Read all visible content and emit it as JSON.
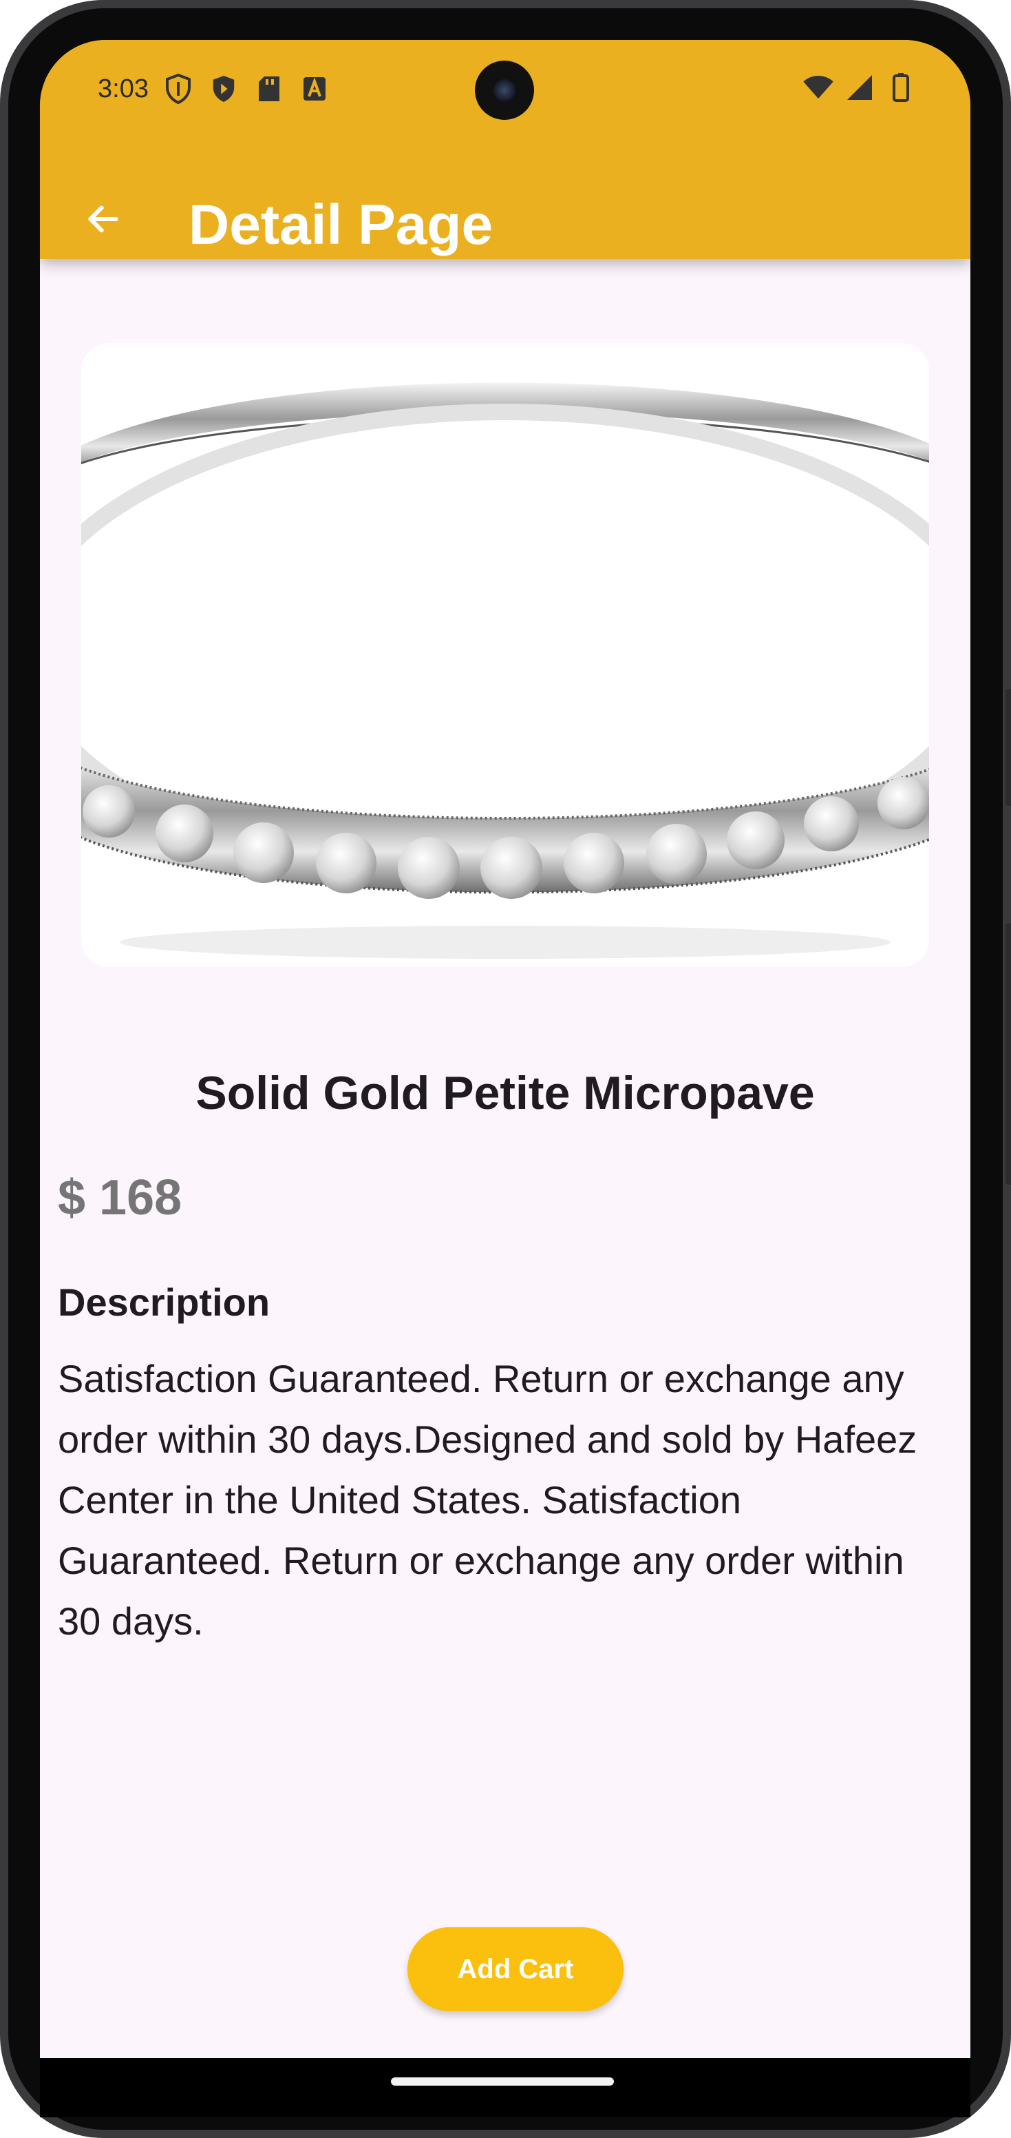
{
  "status_bar": {
    "time": "3:03",
    "left_icons": [
      "shield-outline-icon",
      "shield-filled-icon",
      "sd-card-icon",
      "font-a-icon"
    ],
    "right_icons": [
      "wifi-icon",
      "signal-icon",
      "battery-icon"
    ]
  },
  "app_bar": {
    "title": "Detail Page",
    "back_icon": "arrow-left-icon",
    "color": "#eab01f"
  },
  "product": {
    "image": "ring-image",
    "name": "Solid Gold Petite Micropave",
    "price": "$ 168",
    "description_heading": "Description",
    "description": "Satisfaction Guaranteed. Return or exchange any order within 30 days.Designed and sold by Hafeez Center in the United States. Satisfaction Guaranteed. Return or exchange any order within 30 days."
  },
  "actions": {
    "add_cart_label": "Add Cart",
    "add_cart_color": "#fbbf0e"
  }
}
